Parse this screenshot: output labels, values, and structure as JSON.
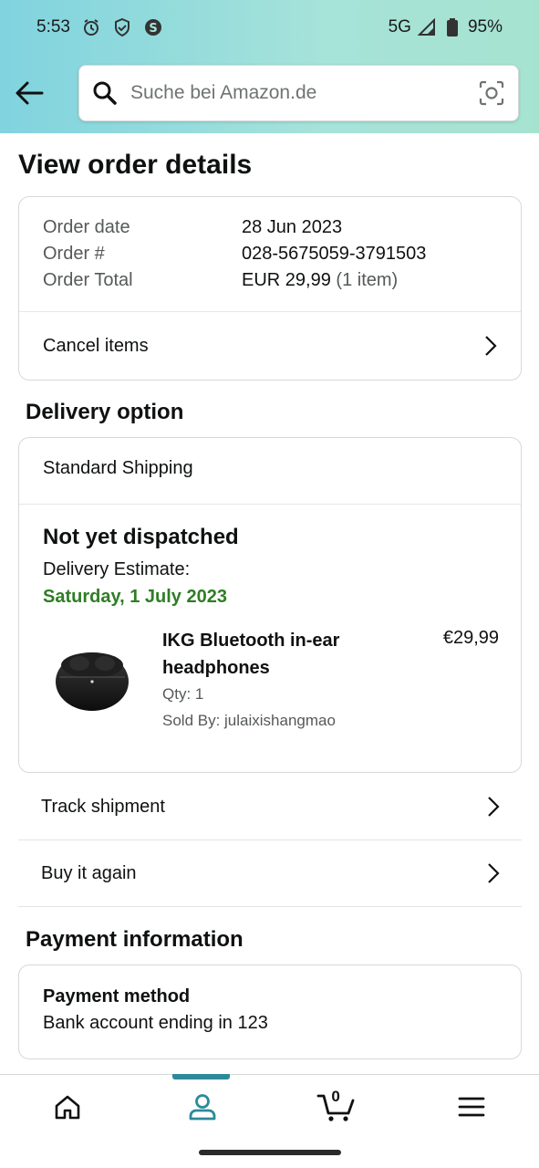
{
  "status": {
    "time": "5:53",
    "network": "5G",
    "battery": "95%"
  },
  "search": {
    "placeholder": "Suche bei Amazon.de"
  },
  "page_title": "View order details",
  "order": {
    "date_label": "Order date",
    "date_value": "28 Jun 2023",
    "number_label": "Order #",
    "number_value": "028-5675059-3791503",
    "total_label": "Order Total",
    "total_value": "EUR 29,99",
    "total_items": "(1 item)",
    "cancel_label": "Cancel items"
  },
  "delivery": {
    "heading": "Delivery option",
    "shipping": "Standard Shipping",
    "status": "Not yet dispatched",
    "estimate_label": "Delivery Estimate:",
    "estimate_date": "Saturday, 1 July 2023",
    "product": {
      "title": "IKG Bluetooth in-ear headphones",
      "price": "€29,99",
      "qty": "Qty: 1",
      "seller": "Sold By: julaixishangmao"
    }
  },
  "actions": {
    "track": "Track shipment",
    "buy_again": "Buy it again"
  },
  "payment": {
    "heading": "Payment information",
    "method_label": "Payment method",
    "method_value": "Bank account ending in 123"
  },
  "nav": {
    "cart_count": "0",
    "active": "account"
  },
  "colors": {
    "accent": "#2c8a9a",
    "green": "#2f7d25"
  }
}
